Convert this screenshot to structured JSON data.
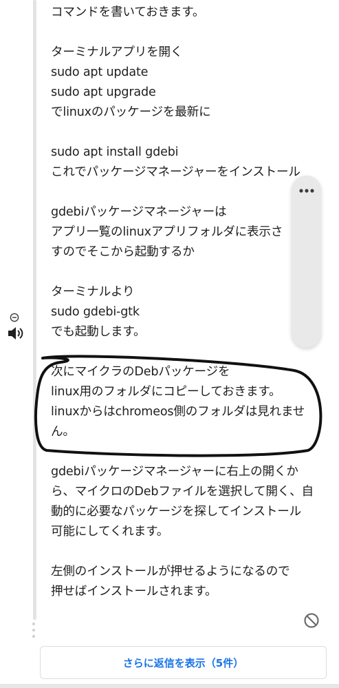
{
  "comment": {
    "lines": [
      "コマンドを書いておきます。",
      "",
      "ターミナルアプリを開く",
      "sudo apt update",
      "sudo apt upgrade",
      "でlinuxのパッケージを最新に",
      "",
      "sudo apt install gdebi",
      "これでパッケージマネージャーをインストール",
      "",
      "gdebiパッケージマネージャーは",
      "アプリ一覧のlinuxアプリフォルダに表示さ",
      "すのでそこから起動するか",
      "",
      "ターミナルより",
      "sudo gdebi-gtk",
      "でも起動します。",
      "",
      "次にマイクラのDebパッケージを",
      "linux用のフォルダにコピーしておきます。",
      "linuxからはchromeos側のフォルダは見れませ",
      "ん。",
      "",
      "gdebiパッケージマネージャーに右上の開くか",
      "ら、マイクロのDebファイルを選択して開く、自",
      "動的に必要なパッケージを探してインストール",
      "可能にしてくれます。",
      "",
      "左側のインストールが押せるようになるので",
      "押せばインストールされます。"
    ]
  },
  "media_panel": {
    "more_icon": "more-horizontal-icon",
    "minus_icon": "minus-circle-icon",
    "volume_icon": "volume-icon"
  },
  "block_icon": "block-icon",
  "more_replies": {
    "label": "さらに返信を表示（5件）"
  },
  "colors": {
    "link": "#1a73e8",
    "text": "#1f1f1f",
    "annotation": "#111111"
  }
}
